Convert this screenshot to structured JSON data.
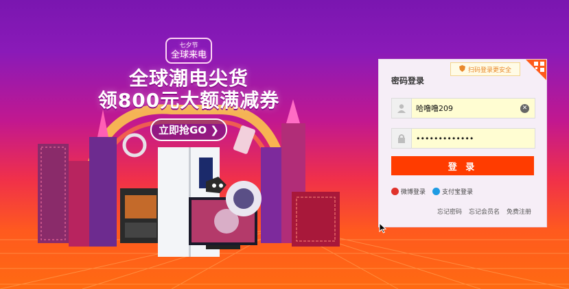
{
  "promo": {
    "event_top": "七夕节",
    "event_name": "全球来电",
    "headline_1": "全球潮电尖货",
    "headline_2": "领800元大额满减券",
    "cta": "立即抢GO"
  },
  "login": {
    "title": "密码登录",
    "qr_tip": "扫码登录更安全",
    "username_value": "哈噜噜209",
    "password_value": "•••••••••••••",
    "submit_label": "登 录",
    "social": {
      "weibo": "微博登录",
      "alipay": "支付宝登录"
    },
    "links": {
      "forgot_password": "忘记密码",
      "forgot_username": "忘记会员名",
      "register": "免费注册"
    }
  },
  "colors": {
    "brand_orange": "#ff3c00",
    "field_fill": "#fffdd2",
    "panel_bg": "#f6eef7"
  },
  "icons": {
    "user": "user-icon",
    "lock": "lock-icon",
    "clear": "clear-icon",
    "shield": "shield-icon",
    "qr": "qr-code-icon",
    "weibo": "weibo-icon",
    "alipay": "alipay-icon"
  }
}
